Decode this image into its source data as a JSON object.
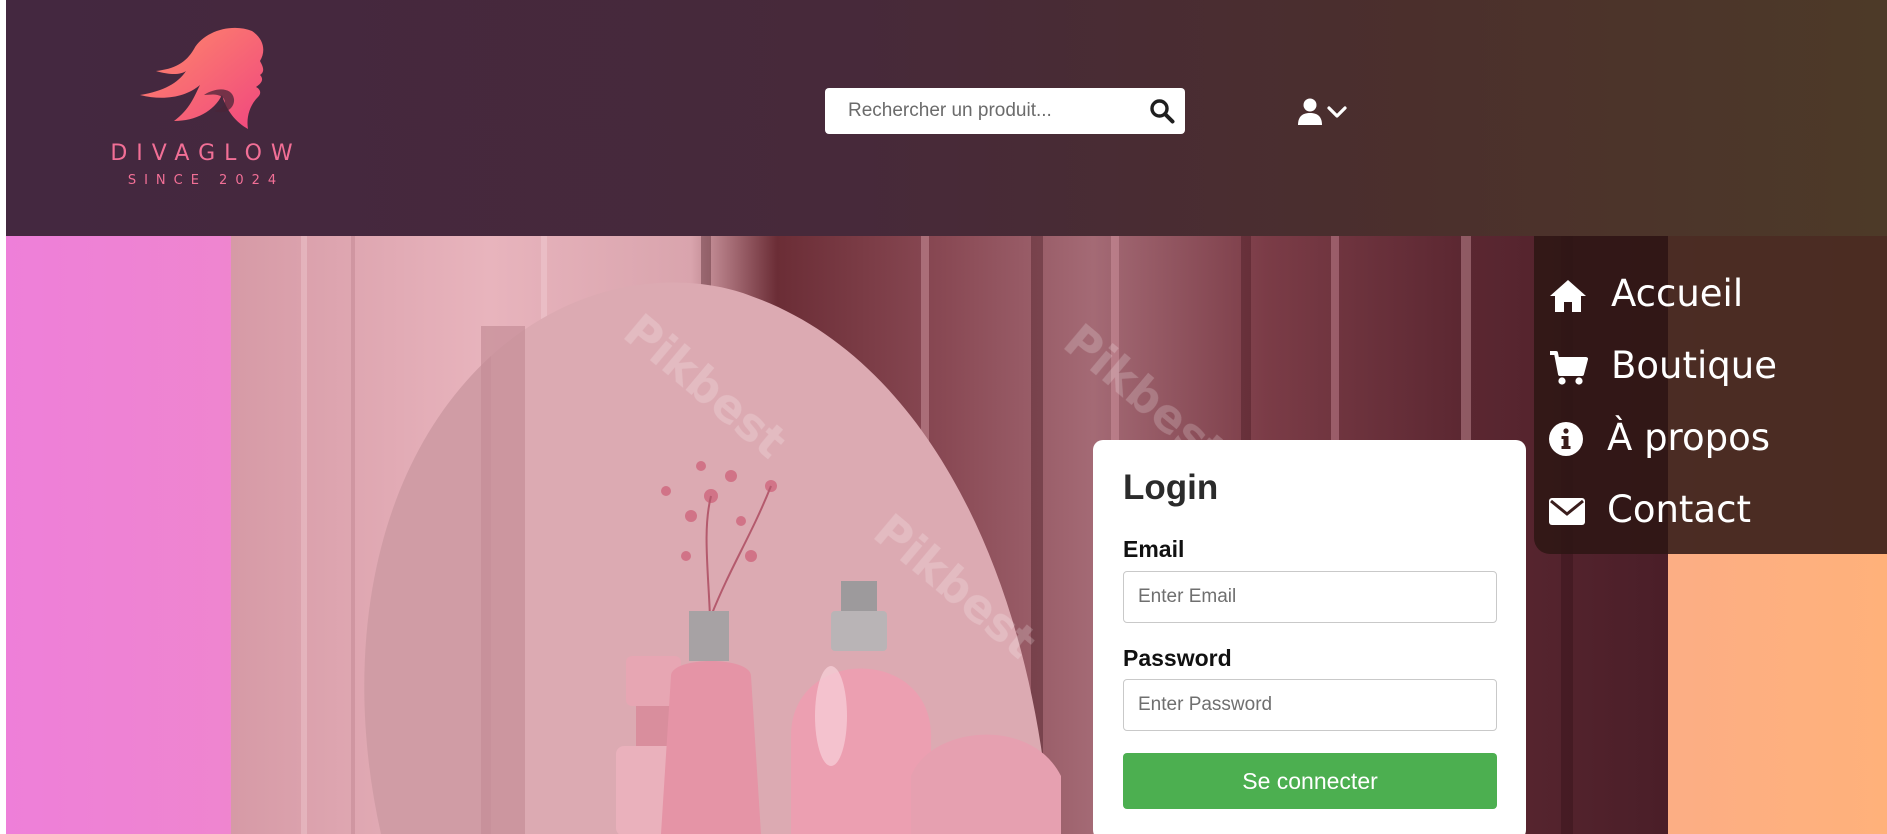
{
  "brand": {
    "name": "DIVAGLOW",
    "tagline": "SINCE 2024",
    "color": "#f26f96"
  },
  "search": {
    "placeholder": "Rechercher un produit...",
    "icon": "search-icon"
  },
  "user_menu": {
    "icons": [
      "user-icon",
      "chevron-down-icon"
    ]
  },
  "nav": {
    "items": [
      {
        "label": "Accueil",
        "icon": "home-icon"
      },
      {
        "label": "Boutique",
        "icon": "cart-icon"
      },
      {
        "label": "À propos",
        "icon": "info-icon"
      },
      {
        "label": "Contact",
        "icon": "envelope-icon"
      }
    ]
  },
  "login": {
    "title": "Login",
    "email_label": "Email",
    "email_placeholder": "Enter Email",
    "password_label": "Password",
    "password_placeholder": "Enter Password",
    "submit_label": "Se connecter",
    "submit_color": "#4caf50"
  },
  "hero": {
    "watermark": "Pikbest"
  }
}
